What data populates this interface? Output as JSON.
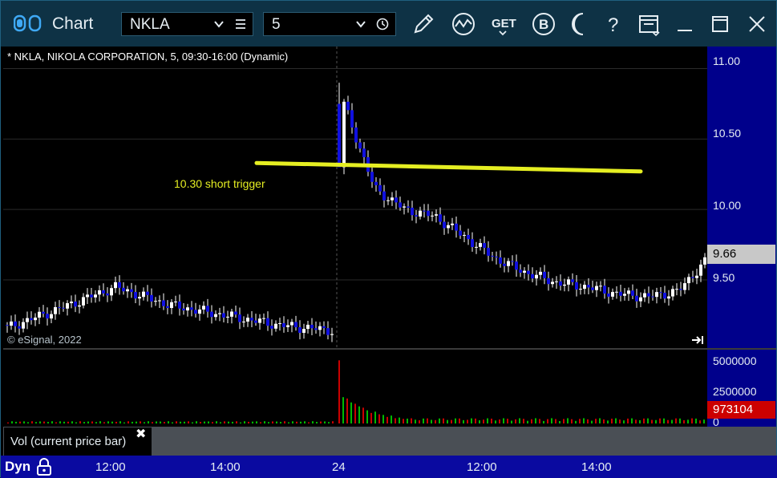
{
  "window": {
    "app_title": "Chart"
  },
  "toolbar": {
    "symbol": "NKLA",
    "interval": "5",
    "icons": [
      "settings-toggle-icon",
      "pencil-icon",
      "study-icon",
      "get-icon",
      "b-icon",
      "moon-icon",
      "help-icon",
      "page-setup-icon",
      "minimize-icon",
      "maximize-icon",
      "close-icon"
    ],
    "get_label": "GET",
    "b_label": "B",
    "help_label": "?"
  },
  "chart": {
    "title": "* NKLA, NIKOLA CORPORATION, 5, 09:30-16:00 (Dynamic)",
    "copyright": "© eSignal, 2022",
    "annotation": "10.30 short trigger",
    "last_price": "9.66",
    "y_ticks": [
      "11.00",
      "10.50",
      "10.00",
      "9.50"
    ],
    "colors": {
      "up": "#ffffff",
      "down": "#1010e0",
      "trigger_line": "#e5ee22",
      "vol_up": "#00bb00",
      "vol_down": "#cc0000"
    }
  },
  "volume_pane": {
    "legend": "Vol (current price bar)",
    "close_glyph": "✖",
    "y_ticks": [
      "5000000",
      "2500000",
      "0"
    ],
    "last_value": "973104"
  },
  "x_axis": {
    "mode_label": "Dyn",
    "ticks": [
      "12:00",
      "14:00",
      "24",
      "12:00",
      "14:00"
    ]
  },
  "chart_data": {
    "type": "candlestick",
    "title": "* NKLA, NIKOLA CORPORATION, 5, 09:30-16:00 (Dynamic)",
    "ylim": [
      9.05,
      11.1
    ],
    "x_tick_labels": [
      "12:00",
      "14:00",
      "24",
      "12:00",
      "14:00"
    ],
    "day1_close_range": [
      9.1,
      9.5
    ],
    "day2_open": 10.75,
    "day2_high": 10.9,
    "day2_last": 9.66,
    "key_points": [
      {
        "time": "day1 12:00",
        "price": 9.3
      },
      {
        "time": "day1 12:30",
        "price": 9.45
      },
      {
        "time": "day1 14:00",
        "price": 9.25
      },
      {
        "time": "day1 16:00",
        "price": 9.14
      },
      {
        "time": "day2 09:30",
        "price": 10.75
      },
      {
        "time": "day2 10:30",
        "price": 10.0
      },
      {
        "time": "day2 11:00",
        "price": 9.95
      },
      {
        "time": "day2 12:30",
        "price": 9.65
      },
      {
        "time": "day2 14:00",
        "price": 9.45
      },
      {
        "time": "day2 15:00",
        "price": 9.38
      },
      {
        "time": "day2 16:00",
        "price": 9.66
      }
    ],
    "trigger_line": {
      "label": "10.30 short trigger",
      "price": 10.3
    },
    "volume": {
      "ylim": [
        0,
        5000000
      ],
      "peak": 4800000,
      "last": 973104
    }
  }
}
